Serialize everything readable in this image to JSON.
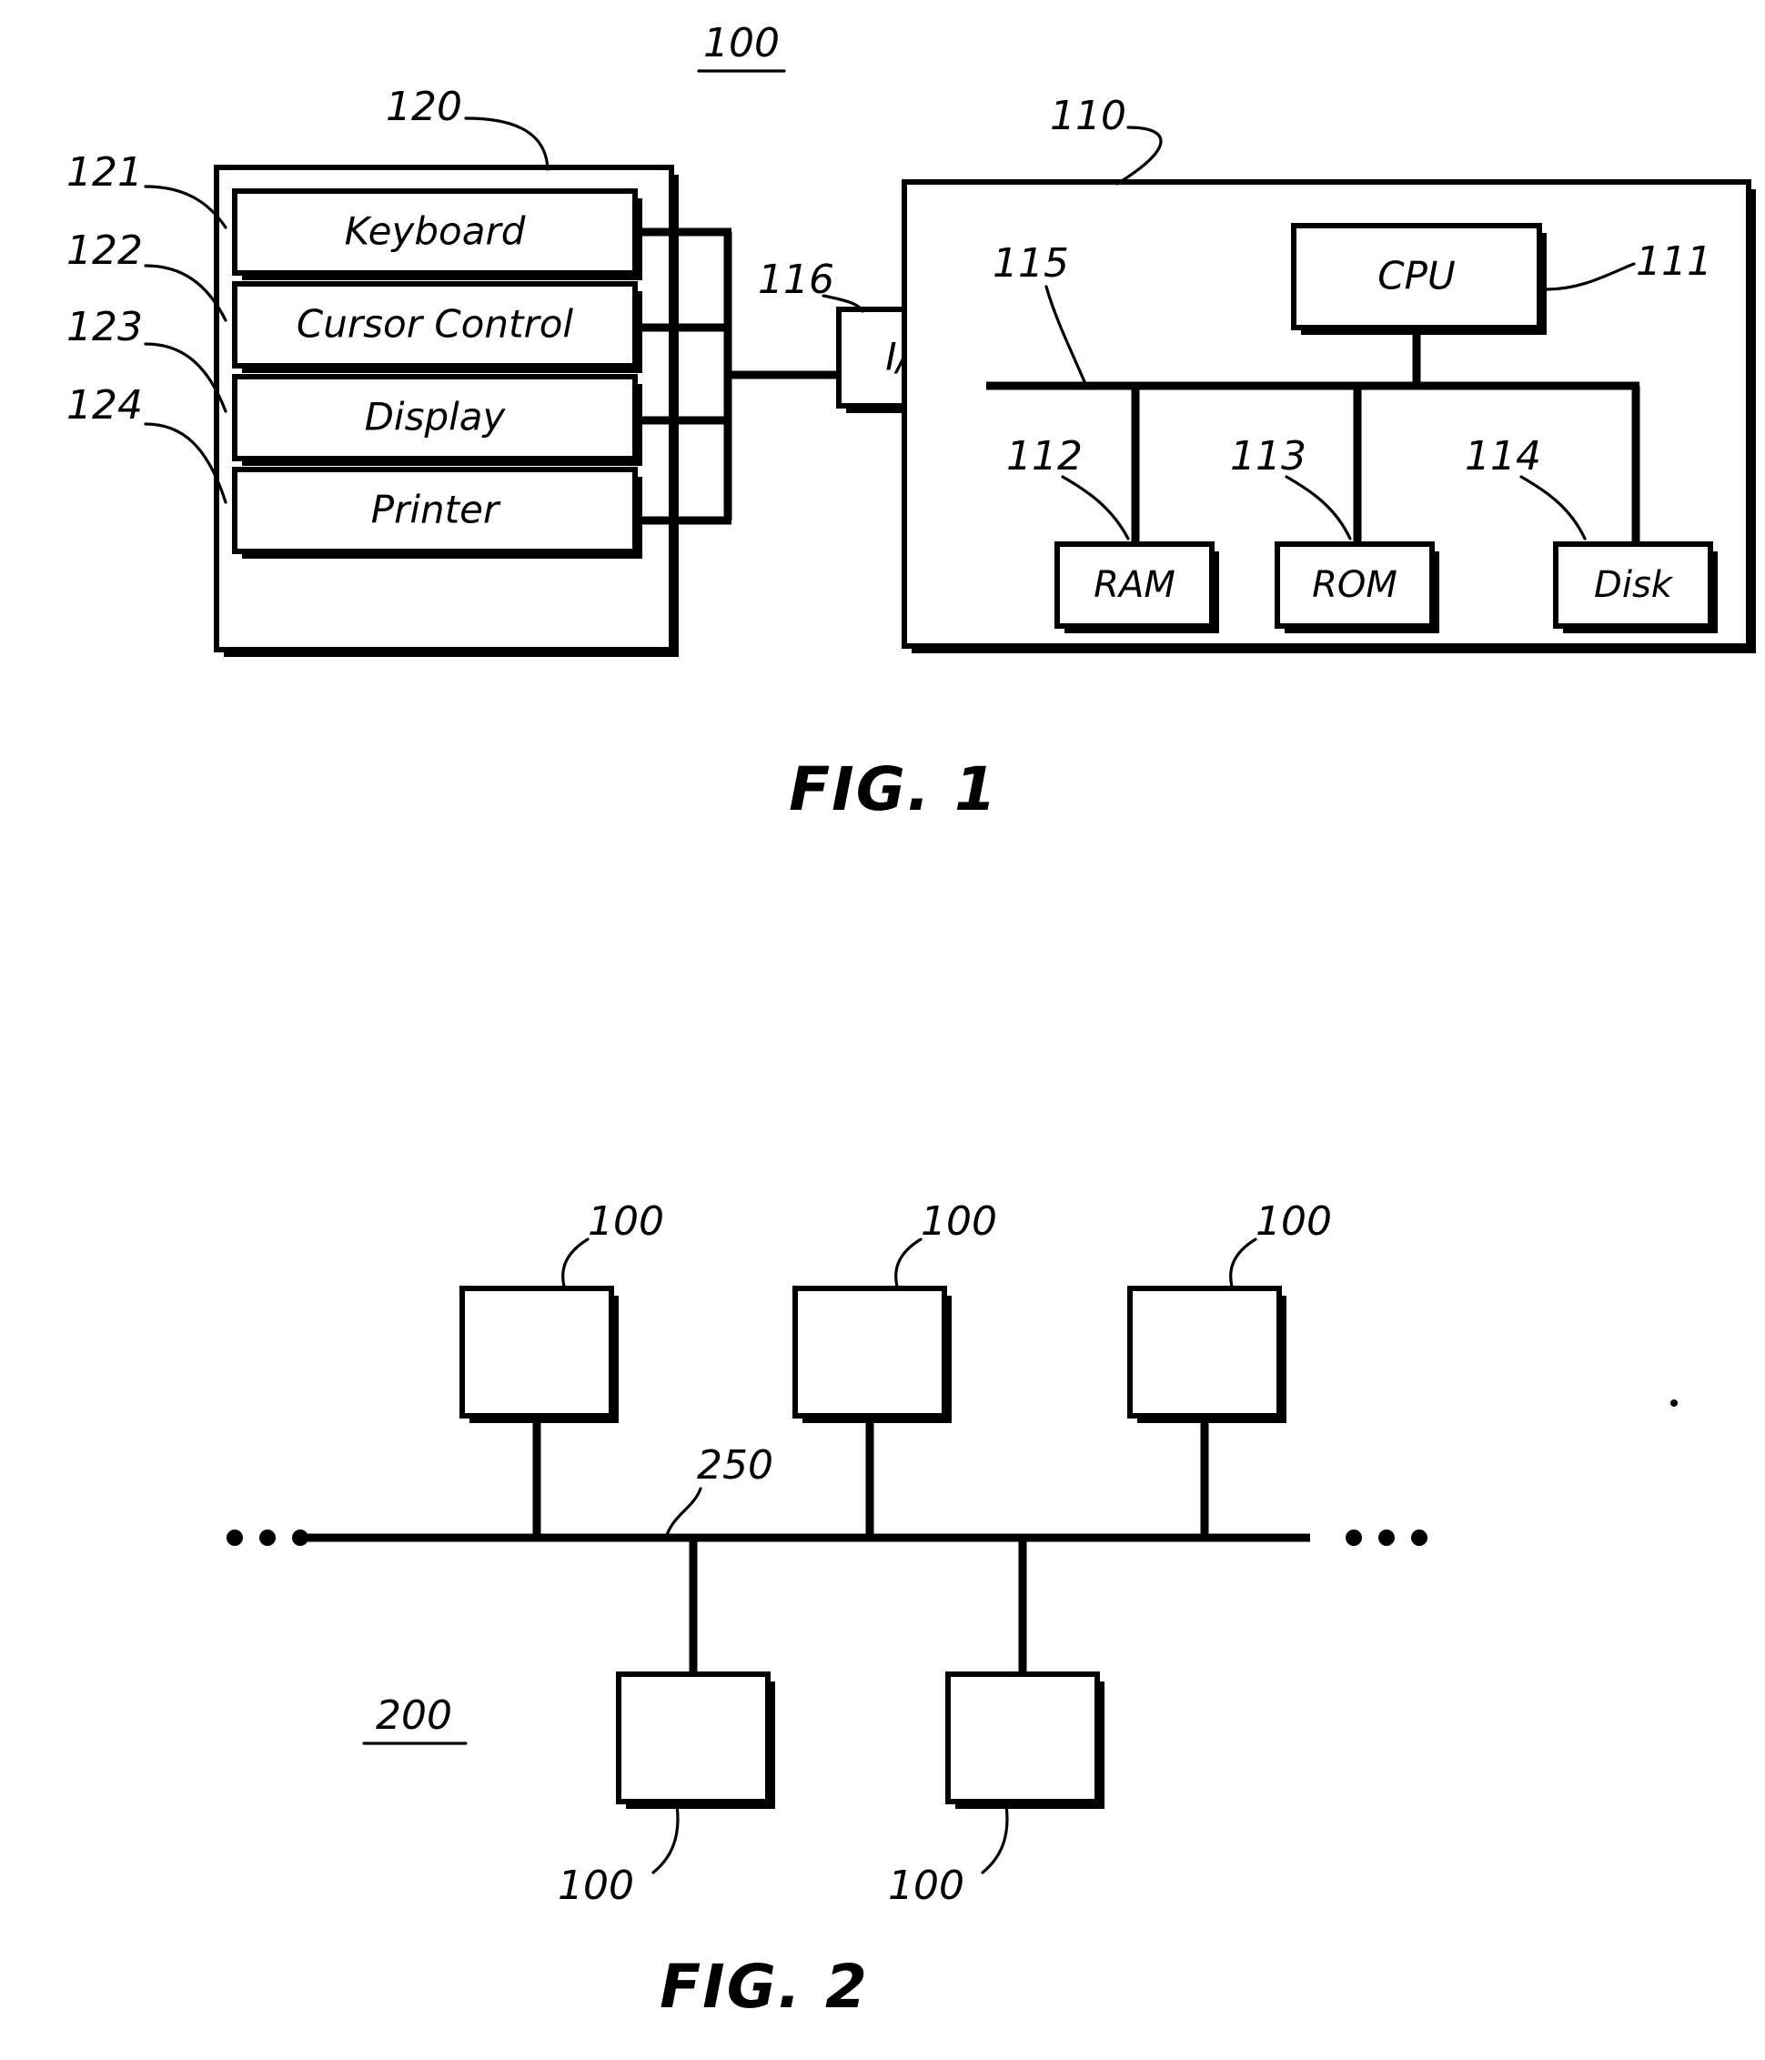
{
  "figures": [
    {
      "id": "fig1",
      "caption": "FIG. 1",
      "system_ref": "100",
      "peripheral_group": {
        "ref": "120",
        "items": [
          {
            "ref": "121",
            "label": "Keyboard"
          },
          {
            "ref": "122",
            "label": "Cursor  Control"
          },
          {
            "ref": "123",
            "label": "Display"
          },
          {
            "ref": "124",
            "label": "Printer"
          }
        ]
      },
      "io": {
        "ref": "116",
        "label": "I/O"
      },
      "computer": {
        "ref": "110",
        "bus_ref": "115",
        "components": [
          {
            "ref": "111",
            "label": "CPU"
          },
          {
            "ref": "112",
            "label": "RAM"
          },
          {
            "ref": "113",
            "label": "ROM"
          },
          {
            "ref": "114",
            "label": "Disk"
          }
        ]
      }
    },
    {
      "id": "fig2",
      "caption": "FIG. 2",
      "network_ref": "200",
      "bus_ref": "250",
      "node_ref": "100",
      "nodes_top": [
        "100",
        "100",
        "100"
      ],
      "nodes_bottom": [
        "100",
        "100"
      ],
      "ellipsis": "..."
    }
  ]
}
